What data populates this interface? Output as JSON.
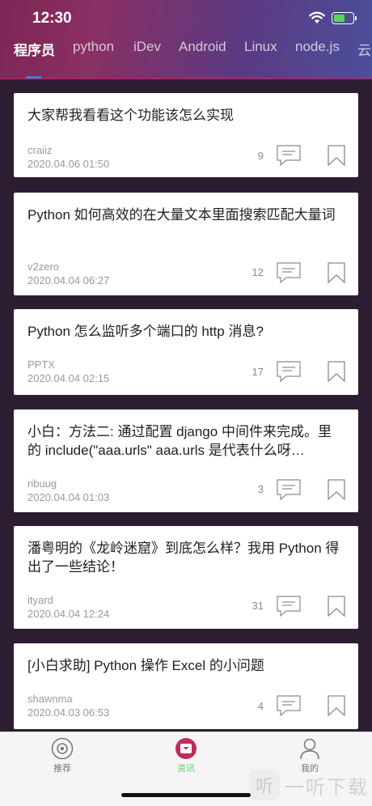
{
  "status_bar": {
    "time": "12:30"
  },
  "tabs": [
    {
      "label": "程序员",
      "active": true
    },
    {
      "label": "python",
      "active": false
    },
    {
      "label": "iDev",
      "active": false
    },
    {
      "label": "Android",
      "active": false
    },
    {
      "label": "Linux",
      "active": false
    },
    {
      "label": "node.js",
      "active": false
    },
    {
      "label": "云",
      "active": false
    }
  ],
  "posts": [
    {
      "title": "大家帮我看看这个功能该怎么实现",
      "author": "craiiz",
      "date": "2020.04.06 01:50",
      "comments": "9"
    },
    {
      "title": "Python 如何高效的在大量文本里面搜索匹配大量词",
      "author": "v2zero",
      "date": "2020.04.04 06:27",
      "comments": "12"
    },
    {
      "title": "Python 怎么监听多个端口的 http 消息?",
      "author": "PPTX",
      "date": "2020.04.04 02:15",
      "comments": "17"
    },
    {
      "title": "小白：方法二: 通过配置 django 中间件来完成。里的 include(\"aaa.urls\" aaa.urls 是代表什么呀…",
      "author": "ribuug",
      "date": "2020.04.04 01:03",
      "comments": "3"
    },
    {
      "title": "潘粤明的《龙岭迷窟》到底怎么样？我用 Python 得出了一些结论！",
      "author": "ityard",
      "date": "2020.04.04 12:24",
      "comments": "31"
    },
    {
      "title": "[小白求助] Python 操作 Excel 的小问题",
      "author": "shawnma",
      "date": "2020.04.03 06:53",
      "comments": "4"
    }
  ],
  "tabbar": [
    {
      "label": "推荐",
      "icon": "record-icon",
      "active": false
    },
    {
      "label": "资讯",
      "icon": "news-icon",
      "active": true
    },
    {
      "label": "我的",
      "icon": "profile-icon",
      "active": false
    }
  ],
  "watermark": {
    "logo": "听",
    "text": "一听下载"
  },
  "colors": {
    "accent": "#c02c58",
    "tab_active": "#5fd35b",
    "indicator": "#3a7be0"
  }
}
